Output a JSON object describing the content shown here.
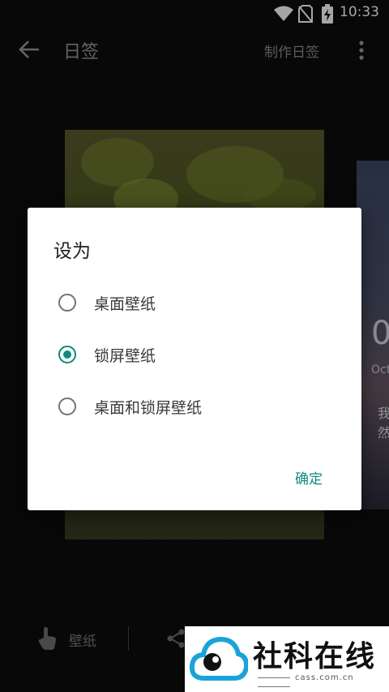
{
  "status_bar": {
    "time": "10:33"
  },
  "app_bar": {
    "title": "日签",
    "make_label": "制作日签"
  },
  "cards": {
    "right_big": "0",
    "right_month": "Oct",
    "right_text_1": "我",
    "right_text_2": "然"
  },
  "dialog": {
    "title": "设为",
    "options": [
      {
        "label": "桌面壁纸",
        "selected": false
      },
      {
        "label": "锁屏壁纸",
        "selected": true
      },
      {
        "label": "桌面和锁屏壁纸",
        "selected": false
      }
    ],
    "confirm_label": "确定"
  },
  "bottom_bar": {
    "wallpaper_label": "壁纸"
  },
  "watermark": {
    "name": "社科在线",
    "url": "cass.com.cn"
  },
  "colors": {
    "accent": "#0f8a7e",
    "dialog_bg": "#ffffff",
    "page_bg": "#0d0d0d"
  }
}
